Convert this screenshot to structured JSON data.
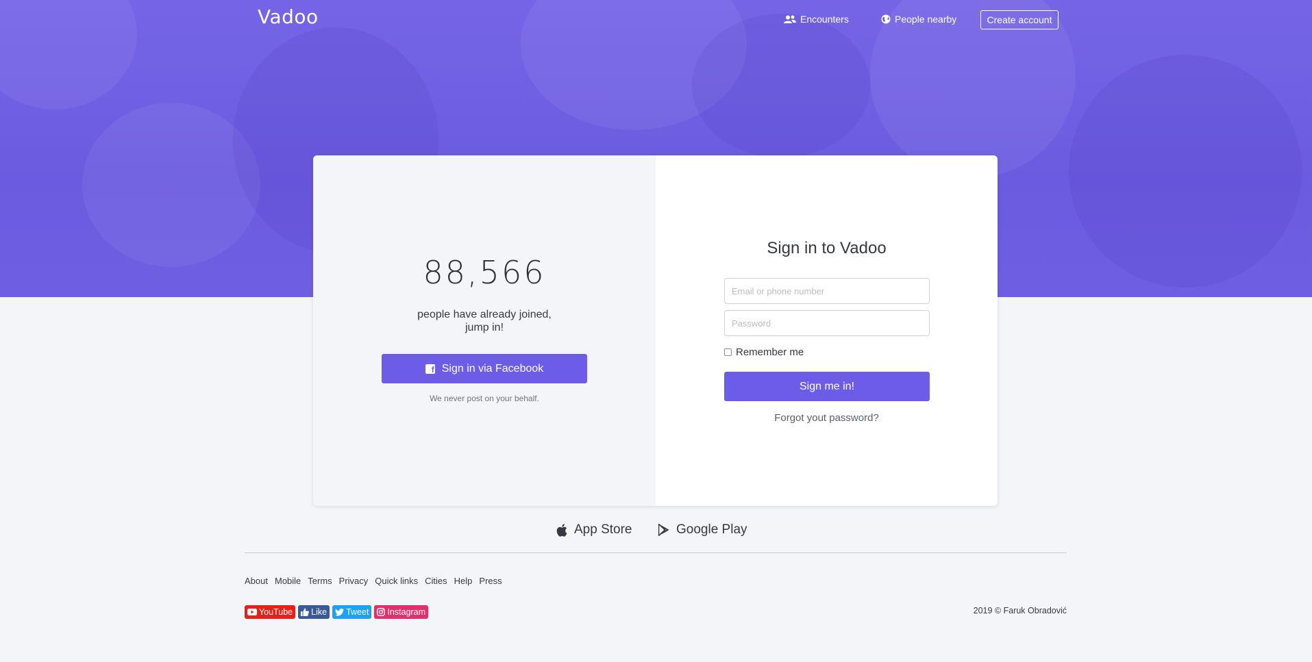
{
  "brand": {
    "logo": "Vadoo",
    "accent": "#6c5ce7"
  },
  "nav": {
    "encounters": "Encounters",
    "people_nearby": "People nearby",
    "create_account": "Create account"
  },
  "promo": {
    "count": "88,566",
    "joined_line1": "people have already joined,",
    "joined_line2": "jump in!",
    "facebook_button": "Sign in via Facebook",
    "note": "We never post on your behalf."
  },
  "signin": {
    "title": "Sign in to Vadoo",
    "email_placeholder": "Email or phone number",
    "password_placeholder": "Password",
    "remember": "Remember me",
    "submit": "Sign me in!",
    "forgot": "Forgot yout password?"
  },
  "stores": {
    "app_store": "App Store",
    "google_play": "Google Play"
  },
  "footer": {
    "links": [
      "About",
      "Mobile",
      "Terms",
      "Privacy",
      "Quick links",
      "Cities",
      "Help",
      "Press"
    ],
    "social": {
      "youtube": "YouTube",
      "like": "Like",
      "tweet": "Tweet",
      "instagram": "Instagram"
    },
    "copyright": "2019 © Faruk Obradović"
  }
}
